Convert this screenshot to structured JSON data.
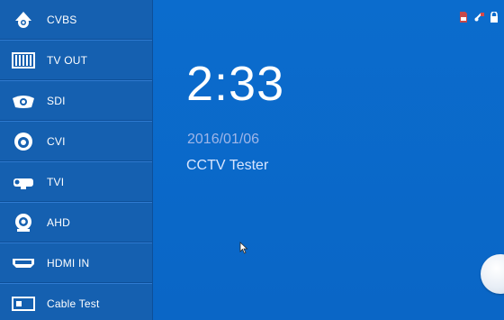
{
  "sidebar": {
    "items": [
      {
        "label": "CVBS",
        "icon": "dome-camera-icon"
      },
      {
        "label": "TV OUT",
        "icon": "tv-out-icon"
      },
      {
        "label": "SDI",
        "icon": "sdi-camera-icon"
      },
      {
        "label": "CVI",
        "icon": "cvi-camera-icon"
      },
      {
        "label": "TVI",
        "icon": "tvi-camera-icon"
      },
      {
        "label": "AHD",
        "icon": "ahd-camera-icon"
      },
      {
        "label": "HDMI IN",
        "icon": "hdmi-icon"
      },
      {
        "label": "Cable Test",
        "icon": "cable-tester-icon"
      }
    ]
  },
  "main": {
    "time": "2:33",
    "date": "2016/01/06",
    "device_name": "CCTV Tester"
  },
  "status_bar": {
    "icons": [
      "sd-card-icon",
      "usb-icon",
      "lock-icon"
    ]
  },
  "colors": {
    "background": "#0a67c8",
    "sidebar": "#1560b0",
    "text": "#ffffff",
    "date_text": "#9fb6e8"
  }
}
